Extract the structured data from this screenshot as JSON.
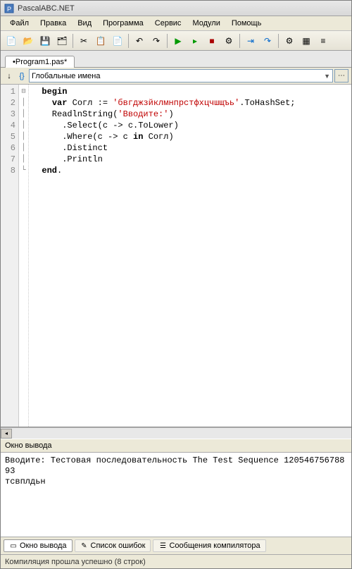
{
  "app": {
    "title": "PascalABC.NET"
  },
  "menu": {
    "items": [
      "Файл",
      "Правка",
      "Вид",
      "Программа",
      "Сервис",
      "Модули",
      "Помощь"
    ]
  },
  "tab": {
    "label": "•Program1.pas*"
  },
  "scope": {
    "label": "Глобальные имена"
  },
  "code": {
    "line_count": 8,
    "lines": [
      {
        "indent": 0,
        "t": [
          {
            "c": "kw",
            "v": "begin"
          }
        ]
      },
      {
        "indent": 1,
        "t": [
          {
            "c": "kw",
            "v": "var"
          },
          {
            "c": "",
            "v": " Согл := "
          },
          {
            "c": "str",
            "v": "'бвгджзйклмнпрстфхцчшщъь'"
          },
          {
            "c": "",
            "v": ".ToHashSet;"
          }
        ]
      },
      {
        "indent": 1,
        "t": [
          {
            "c": "",
            "v": "ReadlnString("
          },
          {
            "c": "str",
            "v": "'Вводите:'"
          },
          {
            "c": "",
            "v": ")"
          }
        ]
      },
      {
        "indent": 2,
        "t": [
          {
            "c": "",
            "v": ".Select(c -> c.ToLower)"
          }
        ]
      },
      {
        "indent": 2,
        "t": [
          {
            "c": "",
            "v": ".Where(c -> c "
          },
          {
            "c": "kw",
            "v": "in"
          },
          {
            "c": "",
            "v": " Согл)"
          }
        ]
      },
      {
        "indent": 2,
        "t": [
          {
            "c": "",
            "v": ".Distinct"
          }
        ]
      },
      {
        "indent": 2,
        "t": [
          {
            "c": "",
            "v": ".Println"
          }
        ]
      },
      {
        "indent": 0,
        "t": [
          {
            "c": "kw",
            "v": "end"
          },
          {
            "c": "",
            "v": "."
          }
        ]
      }
    ]
  },
  "output": {
    "header": "Окно вывода",
    "text": "Вводите: Тестовая последовательность The Test Sequence 12054675678893\nтсвплдьн"
  },
  "bottom_tabs": {
    "items": [
      {
        "icon": "▭",
        "label": "Окно вывода",
        "active": true
      },
      {
        "icon": "✎",
        "label": "Список ошибок",
        "active": false
      },
      {
        "icon": "☰",
        "label": "Сообщения компилятора",
        "active": false
      }
    ]
  },
  "status": {
    "text": "Компиляция прошла успешно (8 строк)"
  }
}
